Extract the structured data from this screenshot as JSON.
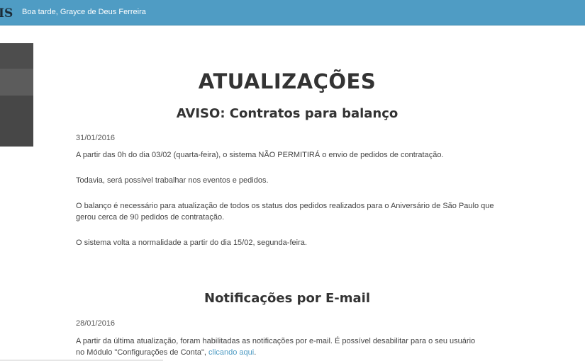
{
  "header": {
    "brand": "IS",
    "greeting": "Boa tarde, Grayce de Deus Ferreira"
  },
  "main": {
    "page_title": "ATUALIZAÇÕES",
    "posts": [
      {
        "title": "AVISO: Contratos para balanço",
        "date": "31/01/2016",
        "paragraphs": [
          "A partir das 0h do dia 03/02 (quarta-feira), o sistema NÃO PERMITIRÁ o envio de pedidos de contratação.",
          "Todavia, será possível trabalhar nos eventos e pedidos.",
          "O balanço é necessário para atualização de todos os status dos pedidos realizados para o Aniversário de São Paulo que gerou cerca de 90 pedidos de contratação.",
          "O sistema volta a normalidade a partir do dia 15/02, segunda-feira."
        ]
      },
      {
        "title": "Notificações por E-mail",
        "date": "28/01/2016",
        "paragraph_text": "A partir da última atualização, foram habilitadas as notificações por e-mail. É possível desabilitar para o seu usuário no Módulo \"Configurações de Conta\",",
        "link_text": "clicando aqui",
        "paragraph_end": "."
      }
    ]
  },
  "colors": {
    "header_bg": "#4f9cc4",
    "sidebar_bg": "#4a4a4a",
    "link": "#4f9cc4"
  }
}
